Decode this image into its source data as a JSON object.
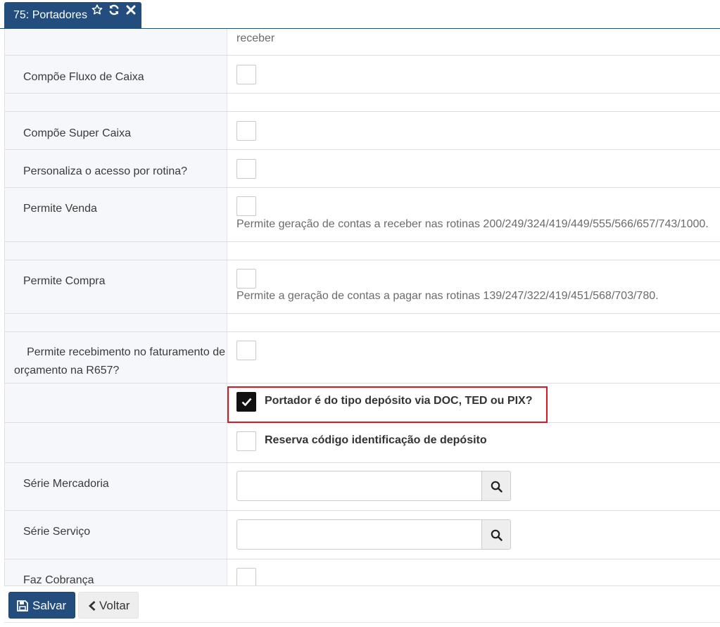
{
  "tab": {
    "title": "75: Portadores",
    "icons": [
      "star-icon",
      "refresh-icon",
      "close-icon"
    ]
  },
  "form": {
    "top_partial_text": "receber",
    "compoe_fluxo_caixa": {
      "label": "Compõe Fluxo de Caixa",
      "checked": false
    },
    "compoe_super_caixa": {
      "label": "Compõe Super Caixa",
      "checked": false
    },
    "personaliza_acesso": {
      "label": "Personaliza o acesso por rotina?",
      "checked": false
    },
    "permite_venda": {
      "label": "Permite Venda",
      "checked": false,
      "hint": "Permite geração de contas a receber nas rotinas 200/249/324/419/449/555/566/657/743/1000."
    },
    "permite_compra": {
      "label": "Permite Compra",
      "checked": false,
      "hint": "Permite a geração de contas a pagar nas rotinas 139/247/322/419/451/568/703/780."
    },
    "permite_recebimento": {
      "label_line1": "Permite recebimento no faturamento de",
      "label_line2": "orçamento na R657?",
      "checked": false
    },
    "deposito_doc_ted_pix": {
      "label": "Portador é do tipo depósito via DOC, TED ou PIX?",
      "checked": true
    },
    "reserva_codigo": {
      "label": "Reserva código identificação de depósito",
      "checked": false
    },
    "serie_mercadoria": {
      "label": "Série Mercadoria",
      "value": ""
    },
    "serie_servico": {
      "label": "Série Serviço",
      "value": ""
    },
    "faz_cobranca": {
      "label": "Faz Cobrança",
      "checked": false
    }
  },
  "footer": {
    "save_label": "Salvar",
    "back_label": "Voltar"
  },
  "colors": {
    "primary": "#234d7c",
    "highlight_border": "#e0141e",
    "label_bg": "#f5f7fa"
  }
}
